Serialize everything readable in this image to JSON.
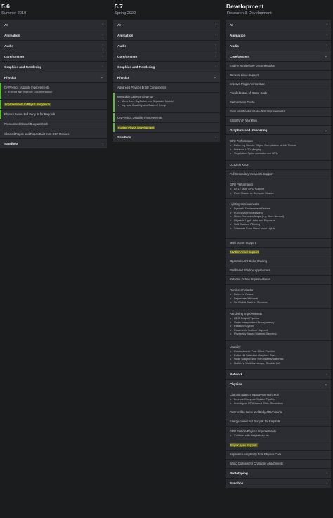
{
  "columns": [
    {
      "version": "5.6",
      "subtitle": "Summer 2019",
      "categories": [
        {
          "label": "AI"
        },
        {
          "label": "Animation"
        },
        {
          "label": "Audio"
        },
        {
          "label": "Core/System"
        },
        {
          "label": "Graphics and Rendering"
        },
        {
          "label": "Physics"
        },
        {
          "label": "Sandbox"
        }
      ],
      "physics_items": [
        {
          "title": "CryPhysics Usability Improvements",
          "bullets": [
            "Extend and Improve Documentation"
          ]
        },
        {
          "title": "Improvements to PhysX Integration",
          "bullets": []
        },
        {
          "title": "Physics Aware Full Body IK for Ragdolls",
          "bullets": []
        },
        {
          "title": "Pressurized Closed Buoyant Cloth",
          "bullets": []
        },
        {
          "title": "Skinned Ropes and Ropes Built from CGF Meshes",
          "bullets": []
        }
      ]
    },
    {
      "version": "5.7",
      "subtitle": "Spring 2020",
      "categories": [
        {
          "label": "AI"
        },
        {
          "label": "Animation"
        },
        {
          "label": "Audio"
        },
        {
          "label": "Core/System"
        },
        {
          "label": "Graphics and Rendering"
        },
        {
          "label": "Physics"
        },
        {
          "label": "Sandbox"
        }
      ],
      "physics_items": [
        {
          "title": "Advanced Physics Entity Components",
          "bullets": []
        },
        {
          "title": "Breakable Objects Clean-up",
          "bullets": [
            "Move from CryAction into Separate Module",
            "Improve Usability and Ease of Setup"
          ]
        },
        {
          "title": "CryPhysics Usability Improvements",
          "bullets": []
        },
        {
          "title": "Further PhysX Development",
          "bullets": []
        }
      ]
    },
    {
      "version": "Development",
      "subtitle": "Research & Development",
      "categories": [
        {
          "label": "AI"
        },
        {
          "label": "Animation"
        },
        {
          "label": "Audio"
        },
        {
          "label": "Core/System"
        },
        {
          "label": "Graphics and Rendering"
        },
        {
          "label": "Network"
        },
        {
          "label": "Physics"
        },
        {
          "label": "Prototyping"
        },
        {
          "label": "Sandbox"
        }
      ],
      "core_items": [
        {
          "title": "Engine Architecture Documentation",
          "bullets": []
        },
        {
          "title": "General Linux Support",
          "bullets": []
        },
        {
          "title": "Improve Plugin Architecture",
          "bullets": []
        },
        {
          "title": "Parallelization of Game Code",
          "bullets": []
        },
        {
          "title": "Performance Guide",
          "bullets": []
        },
        {
          "title": "Push Unit/Feature/Auto-Test Improvements",
          "bullets": []
        },
        {
          "title": "Simplify VR Workflow",
          "bullets": []
        }
      ],
      "graphics_items": [
        {
          "title": "CPU Performance",
          "bullets": [
            "Deferring Render Object Compilation to Job Thread",
            "Instance LOD Merging",
            "Vegetation Spine Animation on GPU"
          ]
        },
        {
          "title": "DX12 on Xbox",
          "bullets": []
        },
        {
          "title": "Full Secondary Viewports Support",
          "bullets": []
        },
        {
          "title": "GPU Performance",
          "bullets": [
            "DX12 Multi GPU Support",
            "Pixel Shader to Compute Shader"
          ]
        },
        {
          "title": "Lighting Improvements",
          "bullets": [
            "Dynamic Environment Probes",
            "FOM/AVSM Shadowing",
            "Micro-Occlusion Maps (e.g. Bent Normal)",
            "Physical Light Units and Exposure",
            "Soft Shadow Filtering",
            "Shadows From Many Local Lights"
          ]
        },
        {
          "title": "Multi Scene Support",
          "bullets": []
        },
        {
          "title": "NVIDIA Ansel Support",
          "bullets": []
        },
        {
          "title": "OpenColourIO Color Grading",
          "bullets": []
        },
        {
          "title": "Prefiltered Shadow Approaches",
          "bullets": []
        },
        {
          "title": "Refactor Octree Implementation",
          "bullets": []
        },
        {
          "title": "Renderer Refactor",
          "bullets": [
            "Deferred Reads",
            "Deprecate XNormal",
            "No Global State in Renderer"
          ]
        },
        {
          "title": "Rendering Improvements",
          "bullets": [
            "HDR Output Pipeline",
            "Order Independent Transparency",
            "Parallax Skybox",
            "Parametric Surface Support",
            "Physically Based Material Blending"
          ]
        },
        {
          "title": "Usability",
          "bullets": [
            "Customizable Post Effect Pipeline",
            "Editor Hit Selection Graphics Pass",
            "Node Graph Editor for Shaders/Materials",
            "Multi UV, Multi Uverwaps, Tileable UV"
          ]
        }
      ],
      "physics_items": [
        {
          "title": "Cloth Simulation Improvements (GPU)",
          "bullets": [
            "Improve Compute Shader Pipeline",
            "Investigate GPU-based Cloth Simulation"
          ]
        },
        {
          "title": "Destructible Items and Body Attachments",
          "bullets": []
        },
        {
          "title": "Energy-based Full Body IK for Ragdolls",
          "bullets": []
        },
        {
          "title": "GPU Particle Physics Improvements",
          "bullets": [
            "Collision with Height Map etc."
          ]
        },
        {
          "title": "PhysX Apex Support",
          "bullets": []
        },
        {
          "title": "Separate LivingEntity from Physics Core",
          "bullets": []
        },
        {
          "title": "World Collision for Character Attachments",
          "bullets": []
        }
      ]
    }
  ],
  "icons": {
    "collapsed": "chevron-right-icon",
    "expanded": "chevron-down-icon"
  },
  "colors": {
    "background": "#1b1c1e",
    "panel": "#2b2d32",
    "accent_green": "#5fb93b",
    "highlight_bg": "#5b5f1e",
    "highlight_text": "#fff56b"
  }
}
